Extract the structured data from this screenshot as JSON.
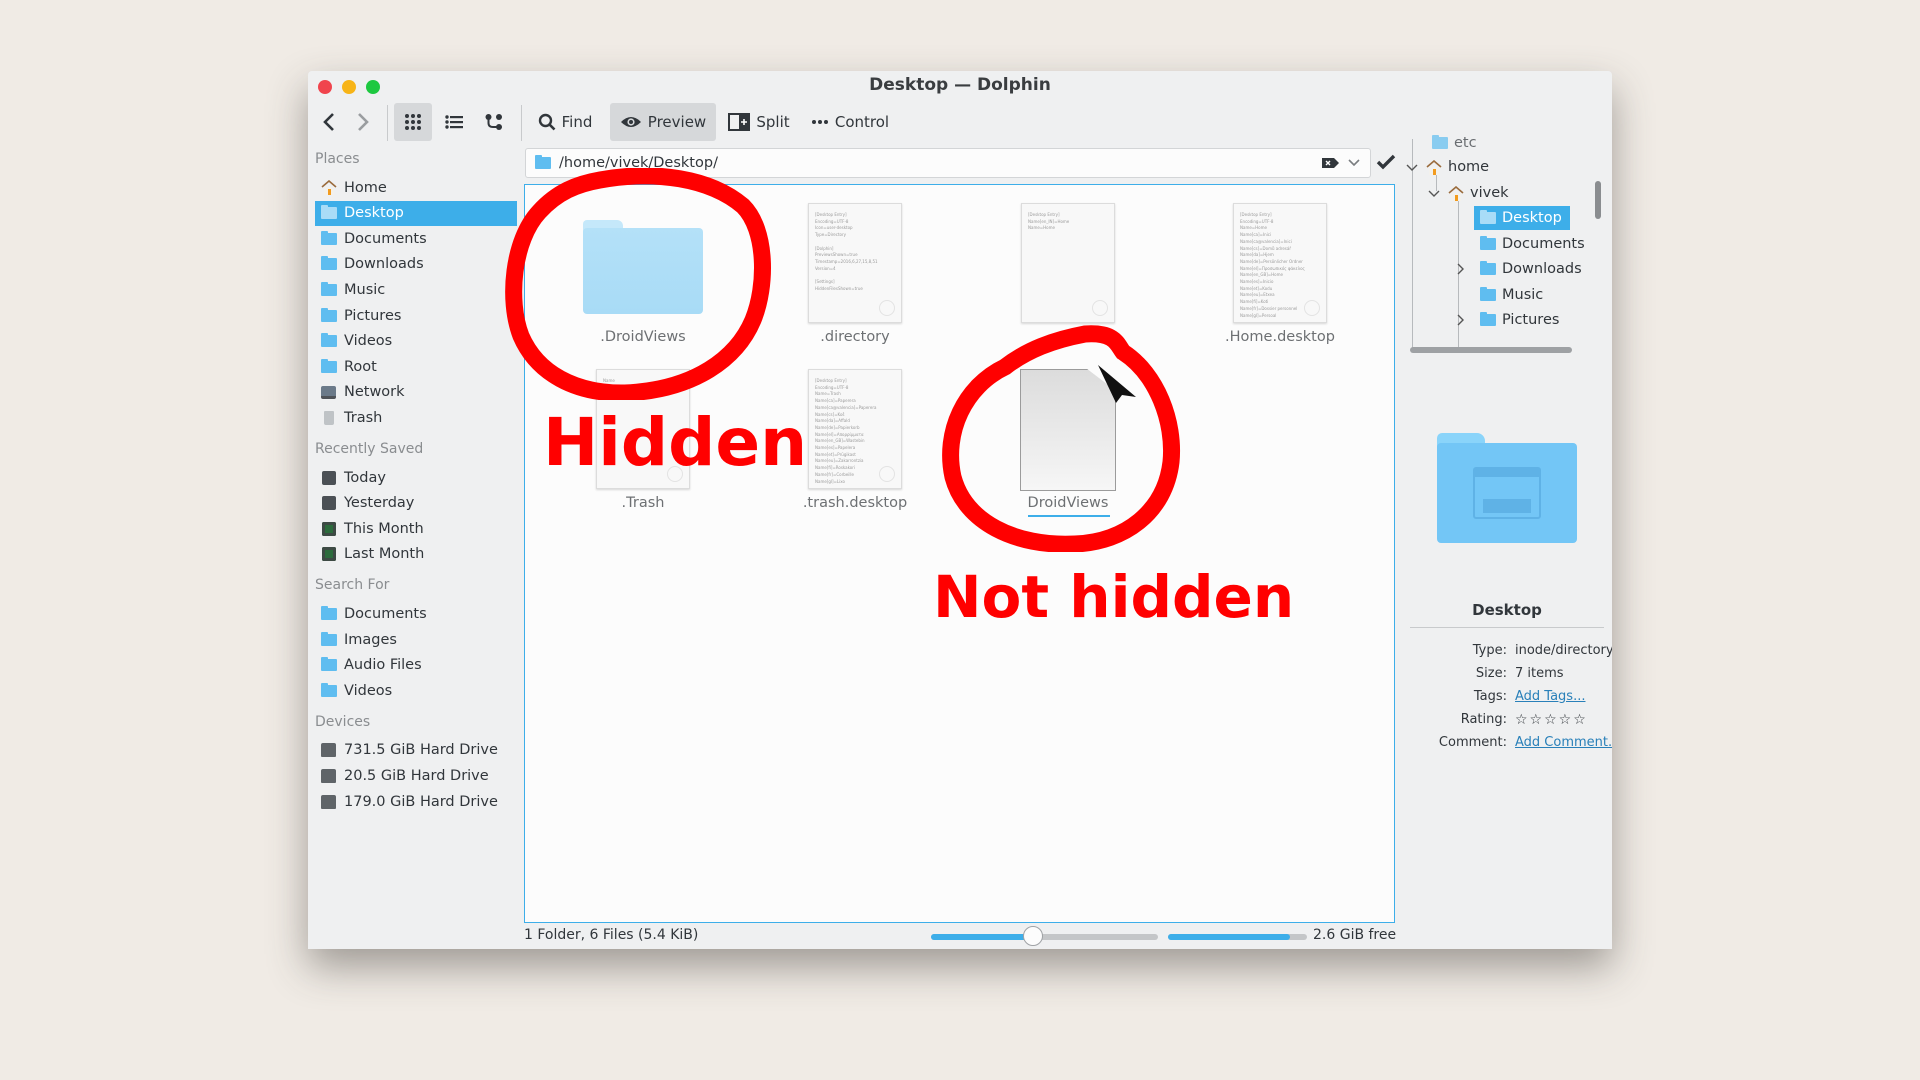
{
  "window": {
    "title": "Desktop — Dolphin",
    "traffic_lights": {
      "close": "#f0444d",
      "minimize": "#f7b417",
      "maximize": "#1dc840"
    }
  },
  "toolbar": {
    "back_icon": "chevron-left-icon",
    "forward_icon": "chevron-right-icon",
    "view_modes": [
      "icons-view",
      "details-view",
      "compact-view"
    ],
    "active_view_mode": "icons-view",
    "find_label": "Find",
    "preview_label": "Preview",
    "preview_active": true,
    "split_label": "Split",
    "control_label": "Control"
  },
  "address_bar": {
    "path": "/home/vivek/Desktop/"
  },
  "sidebar": {
    "sections": [
      {
        "title": "Places",
        "items": [
          {
            "label": "Home",
            "icon": "home-icon"
          },
          {
            "label": "Desktop",
            "icon": "folder-desktop-icon",
            "selected": true
          },
          {
            "label": "Documents",
            "icon": "folder-documents-icon"
          },
          {
            "label": "Downloads",
            "icon": "folder-downloads-icon"
          },
          {
            "label": "Music",
            "icon": "folder-music-icon"
          },
          {
            "label": "Pictures",
            "icon": "folder-pictures-icon"
          },
          {
            "label": "Videos",
            "icon": "folder-videos-icon"
          },
          {
            "label": "Root",
            "icon": "folder-root-icon"
          },
          {
            "label": "Network",
            "icon": "network-icon"
          },
          {
            "label": "Trash",
            "icon": "trash-icon"
          }
        ]
      },
      {
        "title": "Recently Saved",
        "items": [
          {
            "label": "Today",
            "icon": "calendar-today-icon"
          },
          {
            "label": "Yesterday",
            "icon": "calendar-yesterday-icon"
          },
          {
            "label": "This Month",
            "icon": "calendar-this-month-icon"
          },
          {
            "label": "Last Month",
            "icon": "calendar-last-month-icon"
          }
        ]
      },
      {
        "title": "Search For",
        "items": [
          {
            "label": "Documents",
            "icon": "folder-documents-icon"
          },
          {
            "label": "Images",
            "icon": "folder-images-icon"
          },
          {
            "label": "Audio Files",
            "icon": "folder-audio-icon"
          },
          {
            "label": "Videos",
            "icon": "folder-videos-icon"
          }
        ]
      },
      {
        "title": "Devices",
        "items": [
          {
            "label": "731.5 GiB Hard Drive",
            "icon": "hard-drive-icon"
          },
          {
            "label": "20.5 GiB Hard Drive",
            "icon": "hard-drive-icon"
          },
          {
            "label": "179.0 GiB Hard Drive",
            "icon": "hard-drive-icon"
          }
        ]
      }
    ]
  },
  "files": [
    {
      "name": ".DroidViews",
      "type": "folder"
    },
    {
      "name": ".directory",
      "type": "text-preview",
      "preview": "[Desktop Entry]\nEncoding=UTF-8\nIcon=user-desktop\nType=Directory\n\n[Dolphin]\nPreviewsShown=true\nTimestamp=2016,6,27,15,8,51\nVersion=4\n\n[Settings]\nHiddenFilesShown=true"
    },
    {
      "name": "",
      "type": "text-preview",
      "preview": "[Desktop Entry]\nName[en_IN]=Home\nName=Home"
    },
    {
      "name": ".Home.desktop",
      "type": "text-preview",
      "preview": "[Desktop Entry]\nEncoding=UTF-8\nName=Home\nName[ca]=Inici\nName[ca@valencia]=Inici\nName[cs]=Domů adresář\nName[da]=Hjem\nName[de]=Persönlicher Ordner\nName[el]=Προσωπικός φάκελος\nName[en_GB]=Home\nName[es]=Inicio\nName[et]=Kodu\nName[eu]=Etxea\nName[fi]=Koti\nName[fr]=Dossier personnel\nName[gl]=Persoal"
    },
    {
      "name": ".Trash",
      "type": "text-preview",
      "preview": "Name"
    },
    {
      "name": ".trash.desktop",
      "type": "text-preview",
      "preview": "[Desktop Entry]\nEncoding=UTF-8\nName=Trash\nName[ca]=Paperera\nName[ca@valencia]=Paperera\nName[cs]=Koš\nName[da]=Affald\nName[de]=Papierkorb\nName[el]=Απορρίμματα\nName[en_GB]=Wastebin\nName[es]=Papelera\nName[et]=Prügikast\nName[eu]=Zakarrontzia\nName[fi]=Roskakori\nName[fr]=Corbeille\nName[gl]=Lixo"
    },
    {
      "name": "DroidViews",
      "type": "generic-file",
      "hovered": true
    }
  ],
  "status_bar": {
    "summary": "1 Folder, 6 Files (5.4 KiB)",
    "zoom_level_fraction": 0.45,
    "disk_used_fraction": 0.88,
    "free_space": "2.6 GiB free"
  },
  "folders_panel": {
    "nodes": [
      {
        "label": "etc",
        "depth": 1,
        "truncated": true
      },
      {
        "label": "home",
        "depth": 1,
        "expanded": true,
        "icon": "home-icon"
      },
      {
        "label": "vivek",
        "depth": 2,
        "expanded": true,
        "icon": "home-icon"
      },
      {
        "label": "Desktop",
        "depth": 3,
        "selected": true
      },
      {
        "label": "Documents",
        "depth": 3
      },
      {
        "label": "Downloads",
        "depth": 3,
        "expandable": true
      },
      {
        "label": "Music",
        "depth": 3
      },
      {
        "label": "Pictures",
        "depth": 3,
        "expandable": true
      }
    ]
  },
  "info_panel": {
    "name": "Desktop",
    "rows": [
      {
        "key": "Type:",
        "value": "inode/directory"
      },
      {
        "key": "Size:",
        "value": "7 items"
      },
      {
        "key": "Tags:",
        "value": "Add Tags...",
        "link": true
      },
      {
        "key": "Rating:",
        "value": "☆☆☆☆☆",
        "rating": 0,
        "max": 5
      },
      {
        "key": "Comment:",
        "value": "Add Comment...",
        "link": true
      }
    ]
  },
  "annotations": {
    "hidden_label": "Hidden",
    "not_hidden_label": "Not hidden",
    "color": "#ff0000"
  },
  "colors": {
    "accent": "#3daee9",
    "window_bg": "#eff0f1",
    "view_bg": "#fcfcfc",
    "desktop_bg": "#f0ebe5"
  }
}
